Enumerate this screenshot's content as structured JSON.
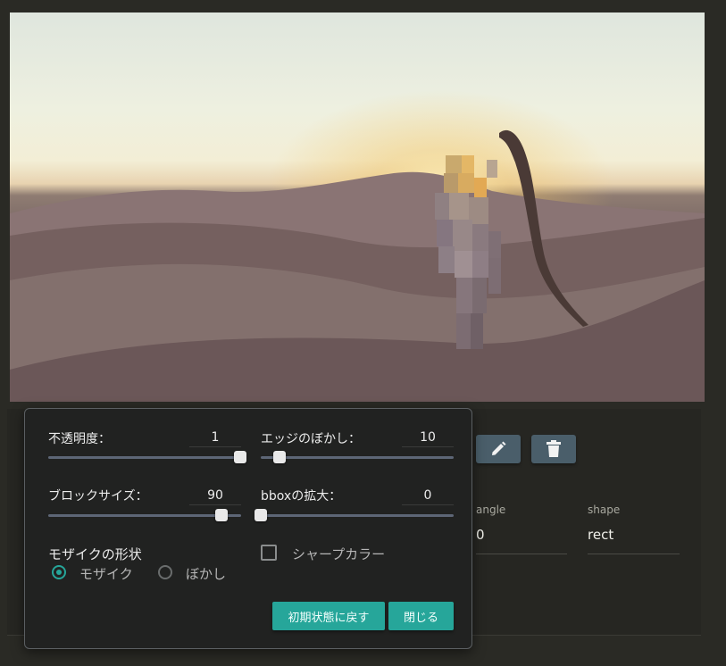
{
  "image": {
    "icon": "desert-photo-with-mosaic",
    "colors": {
      "sky": "#eef0e0",
      "sand": "#7a6664",
      "sun": "#f2c76a"
    }
  },
  "toolbar": {
    "edit_icon": "pencil-icon",
    "delete_icon": "trash-icon"
  },
  "fields": {
    "angle": {
      "label": "angle",
      "value": "0"
    },
    "shape": {
      "label": "shape",
      "value": "rect"
    }
  },
  "popup": {
    "opacity": {
      "label": "不透明度：",
      "value": "1",
      "fraction": 1.0
    },
    "edge_blur": {
      "label": "エッジのぼかし：",
      "value": "10",
      "fraction": 0.1
    },
    "block_size": {
      "label": "ブロックサイズ：",
      "value": "90",
      "fraction": 0.9
    },
    "bbox_expand": {
      "label": "bboxの拡大：",
      "value": "0",
      "fraction": 0.0
    },
    "mosaic_shape": {
      "label": "モザイクの形状",
      "options": [
        "モザイク",
        "ぼかし"
      ],
      "selected": "モザイク"
    },
    "sharp_color": {
      "label": "シャープカラー",
      "checked": false
    },
    "reset_label": "初期状態に戻す",
    "close_label": "閉じる",
    "accent": "#26a69a"
  }
}
